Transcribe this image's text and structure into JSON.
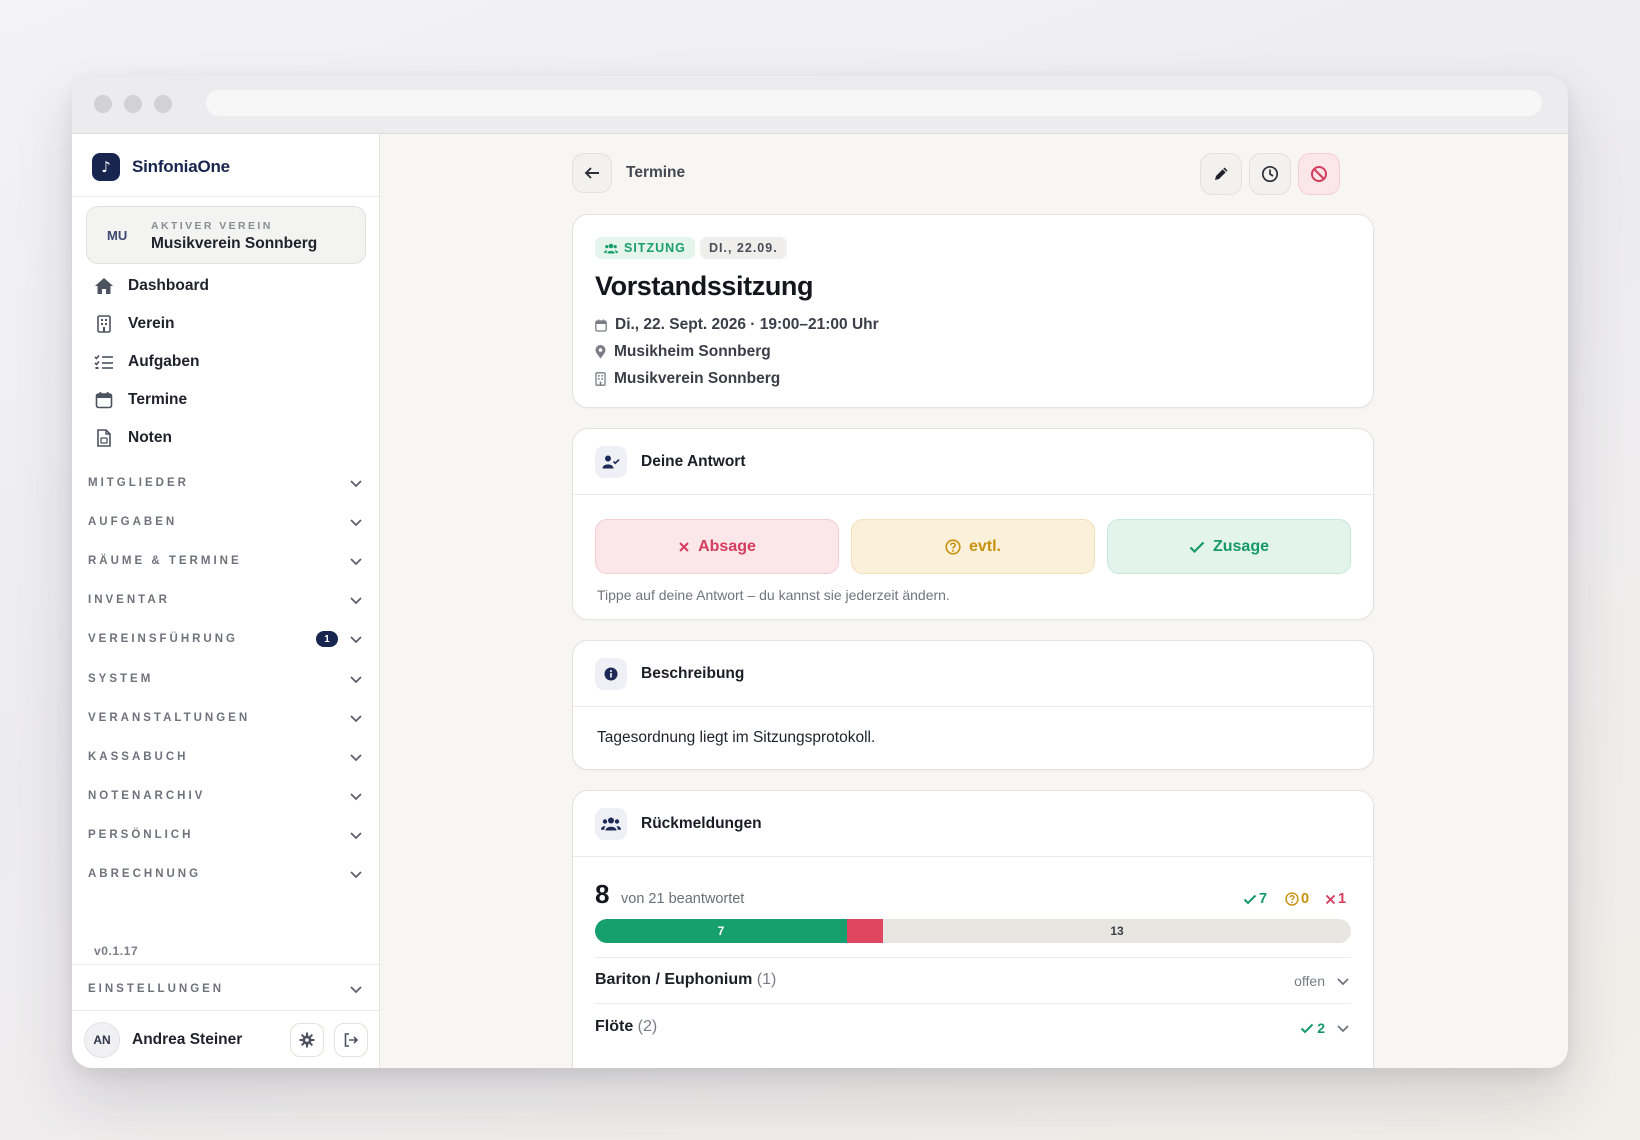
{
  "app": {
    "name": "SinfoniaOne",
    "version": "v0.1.17"
  },
  "club_card": {
    "initials": "MU",
    "label": "AKTIVER VEREIN",
    "name": "Musikverein Sonnberg"
  },
  "nav": [
    {
      "label": "Dashboard",
      "icon": "home-icon"
    },
    {
      "label": "Verein",
      "icon": "building-icon"
    },
    {
      "label": "Aufgaben",
      "icon": "list-check-icon"
    },
    {
      "label": "Termine",
      "icon": "calendar-icon"
    },
    {
      "label": "Noten",
      "icon": "document-icon"
    }
  ],
  "groups": [
    {
      "label": "MITGLIEDER"
    },
    {
      "label": "AUFGABEN"
    },
    {
      "label": "RÄUME & TERMINE"
    },
    {
      "label": "INVENTAR"
    },
    {
      "label": "VEREINSFÜHRUNG",
      "badge": "1"
    },
    {
      "label": "SYSTEM"
    },
    {
      "label": "VERANSTALTUNGEN"
    },
    {
      "label": "KASSABUCH"
    },
    {
      "label": "NOTENARCHIV"
    },
    {
      "label": "PERSÖNLICH"
    },
    {
      "label": "ABRECHNUNG"
    }
  ],
  "settings_group": {
    "label": "EINSTELLUNGEN"
  },
  "user": {
    "initials": "AN",
    "name": "Andrea Steiner"
  },
  "header": {
    "breadcrumb": "Termine"
  },
  "event": {
    "type_badge": "SITZUNG",
    "date_badge": "DI., 22.09.",
    "title": "Vorstandssitzung",
    "datetime": "Di., 22. Sept. 2026 · 19:00–21:00 Uhr",
    "location": "Musikheim Sonnberg",
    "organizer": "Musikverein Sonnberg"
  },
  "response": {
    "title": "Deine Antwort",
    "decline": "Absage",
    "maybe": "evtl.",
    "accept": "Zusage",
    "hint": "Tippe auf deine Antwort – du kannst sie jederzeit ändern."
  },
  "description": {
    "title": "Beschreibung",
    "text": "Tagesordnung liegt im Sitzungsprotokoll."
  },
  "feedback": {
    "title": "Rückmeldungen",
    "answered": "8",
    "answered_label": "von 21 beantwortet",
    "total": 21,
    "yes": "7",
    "maybe": "0",
    "no": "1",
    "bar_yes_label": "7",
    "bar_open_label": "13",
    "open_count": 13,
    "groups": [
      {
        "name": "Bariton / Euphonium",
        "count": "(1)",
        "status": "offen"
      },
      {
        "name": "Flöte",
        "count": "(2)",
        "status": "2"
      }
    ]
  },
  "colors": {
    "brand": "#17254f",
    "yes": "#17986a",
    "maybe": "#c9920e",
    "no": "#d53d5d"
  }
}
